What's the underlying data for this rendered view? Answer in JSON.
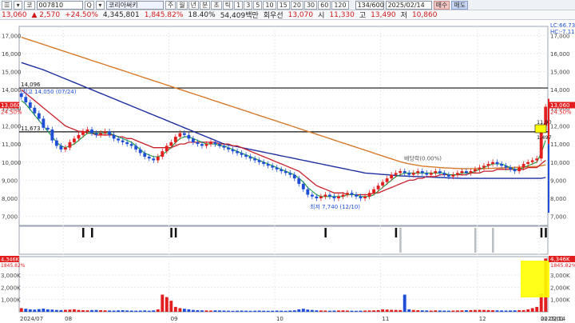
{
  "toolbar": {
    "left_icons": [
      "☰",
      "▾"
    ],
    "code_label": "코",
    "code": "007810",
    "search": "Q",
    "name_btn": "▾",
    "name": "코리아써키",
    "periods": [
      "주",
      "월",
      "년",
      "분",
      "초",
      "틱",
      "1",
      "3",
      "5",
      "10",
      "15",
      "20",
      "30",
      "60",
      "120"
    ],
    "count": "134/600",
    "date": "2025/02/14",
    "buy": "매수",
    "sell": "매도"
  },
  "quote": {
    "price": "13,060",
    "change": "▲ 2,570",
    "change_pct": "+24.50%",
    "volume": "4,345,801",
    "volume_pct": "1,845.82%",
    "turnover_pct": "18.40%",
    "amount": "54,409백만",
    "rotation": "회우선",
    "open": "13,070",
    "high_label": "고",
    "high": "13,490",
    "low_label": "저",
    "low": "10,860",
    "start_label": "시",
    "start": "11,330",
    "high_value": "13,060"
  },
  "chart_data": {
    "type": "candlestick",
    "price_axis": {
      "ylim": [
        6500,
        17500
      ],
      "ticks": [
        "7,000",
        "8,000",
        "9,000",
        "10,000",
        "11,000",
        "12,000",
        "13,000",
        "14,000",
        "15,000",
        "16,000",
        "17,000"
      ]
    },
    "volume_axis": {
      "ylim": [
        0,
        4500
      ],
      "ticks": [
        "1,000K",
        "2,000K",
        "3,000K"
      ]
    },
    "x_labels": [
      "2024/07",
      "08",
      "09",
      "10",
      "11",
      "12",
      "2025/01",
      "02",
      "02/14"
    ],
    "horizontal_lines": [
      14096,
      11673
    ],
    "hline_labels": [
      "14,096",
      "11,673"
    ],
    "annotations": {
      "high": "최고 14,050 (07/24)",
      "low": "최저 7,740 (12/10)",
      "rights": "배당락(0.00%)",
      "right_top_1": "LC:66.73",
      "right_top_2": "HC:-7.11",
      "price_box_top": "11,90",
      "price_box_bottom": "1,497",
      "last_price": "13,060",
      "last_pct": "24.50%",
      "vol_last": "4,346K",
      "vol_last_pct": "1845.82%"
    },
    "close": [
      13600,
      13300,
      13000,
      12700,
      12400,
      11900,
      11800,
      11200,
      10900,
      10700,
      10800,
      11100,
      11300,
      11500,
      11700,
      11800,
      11600,
      11500,
      11600,
      11700,
      11500,
      11300,
      11200,
      11100,
      11000,
      10900,
      10700,
      10500,
      10300,
      10200,
      10100,
      10300,
      10600,
      10900,
      11100,
      11400,
      11600,
      11500,
      11300,
      11100,
      11000,
      10900,
      11000,
      11100,
      11000,
      10900,
      10800,
      10700,
      10600,
      10500,
      10400,
      10300,
      10200,
      10100,
      10000,
      9900,
      9800,
      9700,
      9600,
      9500,
      9400,
      9300,
      9100,
      8800,
      8500,
      8200,
      8100,
      8000,
      8100,
      8200,
      8100,
      8000,
      8100,
      8200,
      8300,
      8200,
      8100,
      8000,
      8100,
      8300,
      8500,
      8700,
      8900,
      9100,
      9300,
      9400,
      9500,
      9400,
      9300,
      9400,
      9500,
      9400,
      9300,
      9400,
      9500,
      9400,
      9300,
      9200,
      9300,
      9400,
      9500,
      9400,
      9500,
      9600,
      9700,
      9800,
      9900,
      10000,
      9900,
      9800,
      9700,
      9600,
      9500,
      9700,
      9900,
      10000,
      10100,
      10200,
      12000,
      13060
    ],
    "ma5": [
      13400,
      13200,
      12900,
      12600,
      12300,
      12000,
      11700,
      11400,
      11100,
      10900,
      10800,
      10900,
      11000,
      11200,
      11400,
      11600,
      11600,
      11600,
      11600,
      11600,
      11600,
      11500,
      11400,
      11300,
      11200,
      11100,
      10900,
      10700,
      10500,
      10400,
      10300,
      10300,
      10400,
      10600,
      10800,
      11100,
      11300,
      11400,
      11400,
      11300,
      11200,
      11100,
      11000,
      11000,
      11000,
      10900,
      10900,
      10800,
      10700,
      10600,
      10500,
      10400,
      10300,
      10200,
      10100,
      10000,
      9900,
      9800,
      9700,
      9600,
      9500,
      9400,
      9300,
      9100,
      8900,
      8600,
      8400,
      8200,
      8100,
      8100,
      8100,
      8100,
      8100,
      8100,
      8200,
      8200,
      8200,
      8100,
      8100,
      8100,
      8200,
      8400,
      8600,
      8800,
      9000,
      9200,
      9300,
      9400,
      9400,
      9400,
      9400,
      9400,
      9400,
      9400,
      9400,
      9400,
      9400,
      9300,
      9300,
      9300,
      9400,
      9400,
      9400,
      9500,
      9600,
      9700,
      9800,
      9900,
      9900,
      9900,
      9800,
      9700,
      9600,
      9600,
      9700,
      9800,
      9900,
      10000,
      10500,
      11200
    ],
    "ma20": [
      14000,
      13800,
      13600,
      13400,
      13200,
      13000,
      12800,
      12600,
      12400,
      12200,
      12000,
      11900,
      11800,
      11700,
      11700,
      11600,
      11600,
      11500,
      11500,
      11500,
      11500,
      11500,
      11400,
      11400,
      11300,
      11300,
      11200,
      11100,
      11000,
      10900,
      10800,
      10800,
      10800,
      10800,
      10800,
      10900,
      11000,
      11000,
      11100,
      11100,
      11100,
      11100,
      11100,
      11100,
      11100,
      11000,
      11000,
      11000,
      10900,
      10900,
      10800,
      10700,
      10600,
      10500,
      10400,
      10300,
      10200,
      10100,
      10000,
      9900,
      9800,
      9700,
      9600,
      9500,
      9300,
      9100,
      8900,
      8700,
      8600,
      8500,
      8400,
      8300,
      8300,
      8300,
      8200,
      8200,
      8200,
      8200,
      8200,
      8200,
      8300,
      8300,
      8400,
      8500,
      8600,
      8700,
      8800,
      8900,
      9000,
      9000,
      9100,
      9100,
      9200,
      9200,
      9200,
      9300,
      9300,
      9300,
      9300,
      9300,
      9300,
      9300,
      9400,
      9400,
      9400,
      9500,
      9500,
      9500,
      9600,
      9600,
      9600,
      9600,
      9600,
      9600,
      9600,
      9700,
      9700,
      9700,
      9900,
      10100
    ],
    "ma60": [
      15500,
      15420,
      15340,
      15260,
      15180,
      15100,
      15000,
      14900,
      14800,
      14700,
      14600,
      14500,
      14400,
      14300,
      14200,
      14100,
      14000,
      13900,
      13800,
      13700,
      13600,
      13500,
      13400,
      13300,
      13200,
      13100,
      13000,
      12900,
      12800,
      12700,
      12600,
      12500,
      12400,
      12300,
      12200,
      12100,
      12000,
      11900,
      11800,
      11700,
      11600,
      11500,
      11400,
      11300,
      11200,
      11100,
      11000,
      10950,
      10900,
      10850,
      10800,
      10750,
      10700,
      10650,
      10600,
      10550,
      10500,
      10450,
      10400,
      10350,
      10300,
      10250,
      10200,
      10150,
      10100,
      10050,
      10000,
      9950,
      9900,
      9850,
      9800,
      9750,
      9700,
      9650,
      9600,
      9550,
      9500,
      9450,
      9400,
      9380,
      9360,
      9340,
      9320,
      9300,
      9280,
      9260,
      9240,
      9230,
      9220,
      9210,
      9200,
      9190,
      9180,
      9170,
      9160,
      9150,
      9140,
      9130,
      9120,
      9110,
      9100,
      9100,
      9100,
      9100,
      9100,
      9100,
      9100,
      9100,
      9100,
      9100,
      9100,
      9100,
      9100,
      9100,
      9100,
      9100,
      9100,
      9100,
      9100,
      9150
    ],
    "ma120": [
      16900,
      16820,
      16740,
      16660,
      16580,
      16500,
      16420,
      16340,
      16260,
      16180,
      16100,
      16020,
      15940,
      15860,
      15780,
      15700,
      15620,
      15540,
      15460,
      15380,
      15300,
      15220,
      15140,
      15060,
      14980,
      14900,
      14820,
      14740,
      14660,
      14580,
      14500,
      14420,
      14340,
      14260,
      14180,
      14100,
      14020,
      13940,
      13860,
      13780,
      13700,
      13620,
      13540,
      13460,
      13380,
      13300,
      13220,
      13140,
      13060,
      12980,
      12900,
      12820,
      12740,
      12660,
      12580,
      12500,
      12420,
      12340,
      12260,
      12180,
      12100,
      12020,
      11940,
      11860,
      11780,
      11700,
      11620,
      11540,
      11460,
      11380,
      11300,
      11220,
      11140,
      11060,
      10980,
      10900,
      10820,
      10740,
      10660,
      10580,
      10500,
      10420,
      10340,
      10260,
      10180,
      10100,
      10020,
      9960,
      9900,
      9860,
      9820,
      9780,
      9760,
      9740,
      9720,
      9700,
      9680,
      9670,
      9660,
      9650,
      9640,
      9640,
      9640,
      9640,
      9640,
      9640,
      9650,
      9660,
      9670,
      9680,
      9690,
      9700,
      9710,
      9720,
      9730,
      9740,
      9750,
      9760,
      9800,
      9850
    ],
    "volume_K": [
      300,
      250,
      200,
      180,
      220,
      260,
      200,
      180,
      150,
      140,
      160,
      180,
      200,
      150,
      130,
      120,
      140,
      150,
      130,
      120,
      110,
      100,
      120,
      130,
      110,
      100,
      90,
      100,
      110,
      90,
      120,
      200,
      1400,
      1200,
      900,
      400,
      300,
      250,
      200,
      150,
      130,
      120,
      110,
      100,
      120,
      110,
      100,
      90,
      80,
      90,
      100,
      90,
      80,
      90,
      100,
      90,
      80,
      90,
      100,
      90,
      80,
      100,
      120,
      200,
      250,
      180,
      150,
      120,
      110,
      100,
      90,
      100,
      110,
      120,
      100,
      90,
      80,
      90,
      100,
      110,
      120,
      130,
      200,
      180,
      160,
      150,
      140,
      1400,
      200,
      150,
      130,
      120,
      110,
      100,
      120,
      110,
      100,
      90,
      100,
      110,
      120,
      130,
      140,
      150,
      160,
      150,
      140,
      130,
      120,
      110,
      100,
      110,
      120,
      130,
      140,
      200,
      300,
      400,
      1500,
      4346
    ]
  }
}
